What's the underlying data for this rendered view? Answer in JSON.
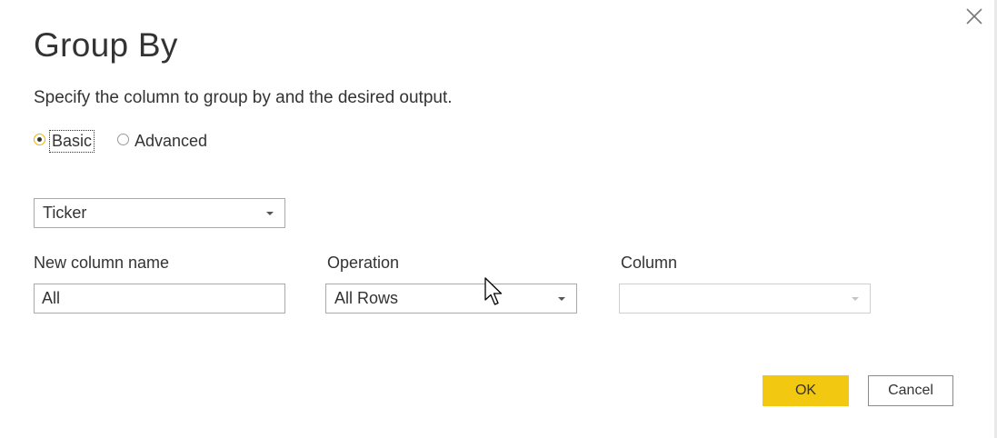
{
  "dialog": {
    "title": "Group By",
    "subtitle": "Specify the column to group by and the desired output.",
    "close_icon": "close-icon"
  },
  "mode": {
    "options": [
      {
        "label": "Basic",
        "selected": true
      },
      {
        "label": "Advanced",
        "selected": false
      }
    ]
  },
  "group_by": {
    "selected": "Ticker"
  },
  "aggregation": {
    "new_column_label": "New column name",
    "new_column_value": "All",
    "operation_label": "Operation",
    "operation_value": "All Rows",
    "column_label": "Column",
    "column_value": ""
  },
  "buttons": {
    "ok": "OK",
    "cancel": "Cancel"
  },
  "colors": {
    "accent": "#f2c811",
    "text": "#333333",
    "border": "#a9a9a9"
  }
}
